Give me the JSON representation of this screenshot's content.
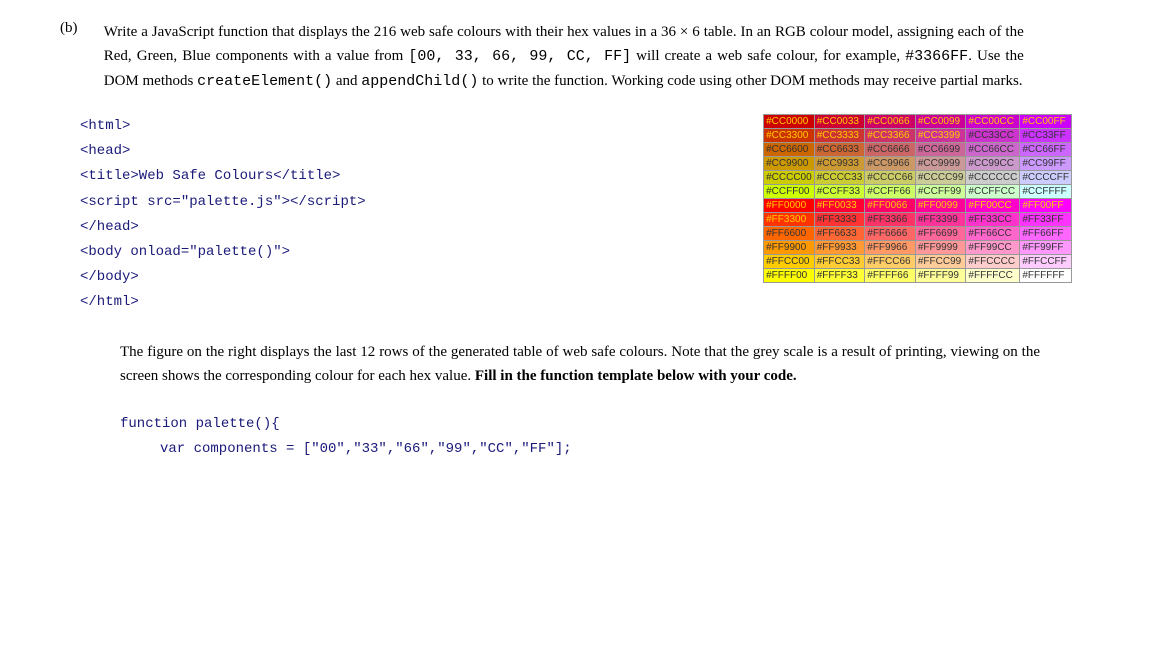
{
  "label": "(b)",
  "q_parts": {
    "t1": "Write a JavaScript function that displays the 216 web safe colours with their hex values in a 36 × 6 table. In an RGB colour model, assigning each of the Red, Green, Blue components with a value from ",
    "c1": "[00, 33, 66, 99, CC, FF]",
    "t2": " will create a web safe colour, for example, ",
    "c2": "#3366FF",
    "t3": ". Use the DOM methods ",
    "c3": "createElement()",
    "t4": " and ",
    "c4": "appendChild()",
    "t5": " to write the function. Working code using other DOM methods may receive partial marks."
  },
  "code": {
    "l1": "<html>",
    "l2": "<head>",
    "l3": "<title>Web Safe Colours</title>",
    "l4": "<script src=\"palette.js\"></script>",
    "l5": "</head>",
    "l6": "<body onload=\"palette()\">",
    "l7": "</body>",
    "l8": "</html>"
  },
  "followup": {
    "t1": "The figure on the right displays the last 12 rows of the generated table of web safe colours. Note that the grey scale is a result of printing, viewing on the screen shows the corresponding colour for each hex value. ",
    "b1": "Fill in the function template below with your code."
  },
  "func": {
    "l1": "function palette(){",
    "l2": "var components = [\"00\",\"33\",\"66\",\"99\",\"CC\",\"FF\"];"
  },
  "chart_data": {
    "type": "table",
    "title": "Web safe colour palette (last 12 rows)",
    "rg_rows": [
      "CC00",
      "CC33",
      "CC66",
      "CC99",
      "CCCC",
      "CCFF",
      "FF00",
      "FF33",
      "FF66",
      "FF99",
      "FFCC",
      "FFFF"
    ],
    "b_cols": [
      "00",
      "33",
      "66",
      "99",
      "CC",
      "FF"
    ],
    "cells": [
      [
        "#CC0000",
        "#CC0033",
        "#CC0066",
        "#CC0099",
        "#CC00CC",
        "#CC00FF"
      ],
      [
        "#CC3300",
        "#CC3333",
        "#CC3366",
        "#CC3399",
        "#CC33CC",
        "#CC33FF"
      ],
      [
        "#CC6600",
        "#CC6633",
        "#CC6666",
        "#CC6699",
        "#CC66CC",
        "#CC66FF"
      ],
      [
        "#CC9900",
        "#CC9933",
        "#CC9966",
        "#CC9999",
        "#CC99CC",
        "#CC99FF"
      ],
      [
        "#CCCC00",
        "#CCCC33",
        "#CCCC66",
        "#CCCC99",
        "#CCCCCC",
        "#CCCCFF"
      ],
      [
        "#CCFF00",
        "#CCFF33",
        "#CCFF66",
        "#CCFF99",
        "#CCFFCC",
        "#CCFFFF"
      ],
      [
        "#FF0000",
        "#FF0033",
        "#FF0066",
        "#FF0099",
        "#FF00CC",
        "#FF00FF"
      ],
      [
        "#FF3300",
        "#FF3333",
        "#FF3366",
        "#FF3399",
        "#FF33CC",
        "#FF33FF"
      ],
      [
        "#FF6600",
        "#FF6633",
        "#FF6666",
        "#FF6699",
        "#FF66CC",
        "#FF66FF"
      ],
      [
        "#FF9900",
        "#FF9933",
        "#FF9966",
        "#FF9999",
        "#FF99CC",
        "#FF99FF"
      ],
      [
        "#FFCC00",
        "#FFCC33",
        "#FFCC66",
        "#FFCC99",
        "#FFCCCC",
        "#FFCCFF"
      ],
      [
        "#FFFF00",
        "#FFFF33",
        "#FFFF66",
        "#FFFF99",
        "#FFFFCC",
        "#FFFFFF"
      ]
    ]
  }
}
